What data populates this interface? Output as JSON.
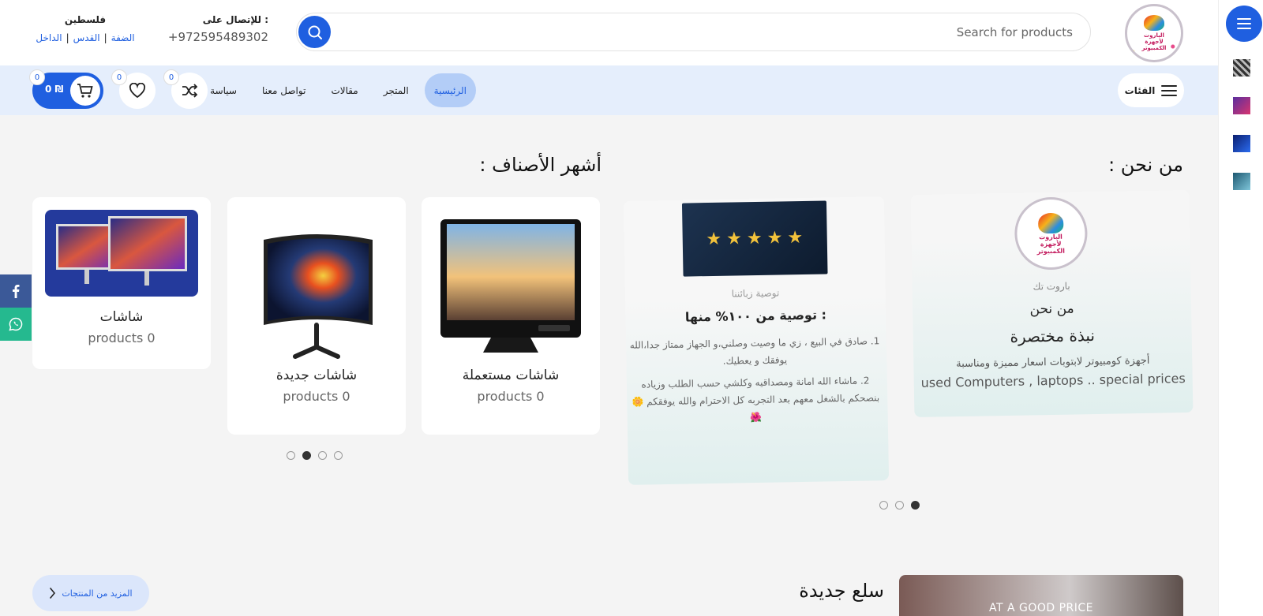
{
  "header": {
    "search_placeholder": "Search for products",
    "contact_label": "للإتصال على :",
    "phone": "+972595489302",
    "region_label": "فلسطين",
    "regions": [
      "الضفة",
      "القدس",
      "الداخل"
    ]
  },
  "logo": {
    "line1": "الباروت",
    "line2": "لأجهزة",
    "line3": "الكمبيوتر"
  },
  "nav": {
    "categories_label": "الفئات",
    "items": [
      {
        "label": "الرئيسية",
        "active": true
      },
      {
        "label": "المتجر"
      },
      {
        "label": "مقالات"
      },
      {
        "label": "تواصل معنا"
      },
      {
        "label": "سياسة البيع"
      }
    ],
    "compare_count": "0",
    "wishlist_count": "0",
    "cart_count": "0",
    "cart_total": "0 ₪"
  },
  "about": {
    "title": "من نحن :",
    "card": {
      "kicker": "باروت تك",
      "heading": "من نحن",
      "subheading": "نبذة مختصرة",
      "text_ar": "أجهزة كومبيوتر لابتوبات اسعار مميزة ومناسبة",
      "text_en": "used Computers , laptops .. special prices"
    },
    "review": {
      "kicker": "توصية زبائننا",
      "heading": "توصية من ١٠٠% منها :",
      "items": [
        "صادق في البيع ، زي ما وصيت وصلني،و الجهاز ممتاز جدا،الله يوفقك و يعطيك.",
        "ماشاء الله امانة ومصداقيه وكلشي حسب الطلب وزياده بنصحكم بالشغل معهم بعد التجربه كل الاحترام والله يوفقكم 🌼🌺"
      ]
    },
    "dots_active": 2
  },
  "categories": {
    "title": "أشهر الأصناف :",
    "items": [
      {
        "name": "شاشات مستعملة",
        "count": "products 0"
      },
      {
        "name": "شاشات جديدة",
        "count": "products 0"
      },
      {
        "name": "شاشات",
        "count": "products 0"
      }
    ],
    "dots_active": 1
  },
  "new_goods": {
    "title": "سلع جديدة",
    "more_label": "المزيد من المنتجات",
    "promo_text": "AT A GOOD PRICE"
  },
  "colors": {
    "accent": "#1f5fe0",
    "nav_bg": "#e5eefc",
    "facebook": "#3b5998",
    "whatsapp": "#25b98f"
  }
}
